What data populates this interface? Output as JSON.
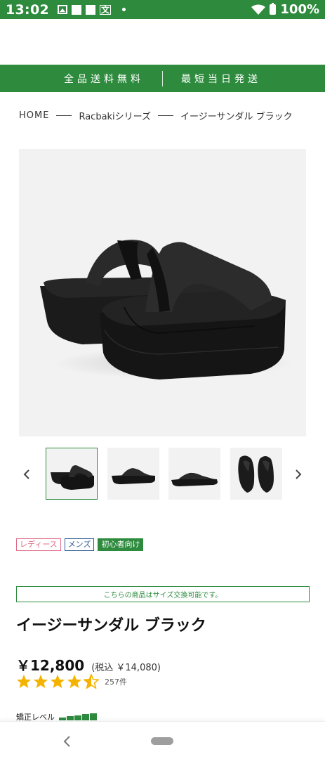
{
  "status_bar": {
    "time": "13:02",
    "battery": "100%",
    "icons": [
      "image-icon",
      "square-icon",
      "square-icon",
      "translate-icon",
      "dot-icon",
      "wifi-icon",
      "battery-icon"
    ]
  },
  "banner": {
    "left": "全品送料無料",
    "right": "最短当日発送"
  },
  "breadcrumb": {
    "items": [
      "HOME",
      "Racbakiシリーズ",
      "イージーサンダル ブラック"
    ]
  },
  "gallery": {
    "main_image": "black-sandal-photo",
    "thumbnails": [
      "sandal-pair-angle",
      "sandal-side",
      "sandal-side-2",
      "sandal-top"
    ],
    "selected_index": 0
  },
  "tags": {
    "ladies": "レディース",
    "mens": "メンズ",
    "beginner": "初心者向け"
  },
  "notice": "こちらの商品はサイズ交換可能です。",
  "product": {
    "title": "イージーサンダル ブラック",
    "price": "￥12,800",
    "tax_included": "(税込 ￥14,080)",
    "rating_value": 4.5,
    "review_count": "257件"
  },
  "correction": {
    "label": "矯正レベル",
    "level": 5
  },
  "colors": {
    "brand_green": "#2e8b3e",
    "star": "#f5b301",
    "ladies": "#e06d86",
    "mens": "#2f5f93"
  }
}
